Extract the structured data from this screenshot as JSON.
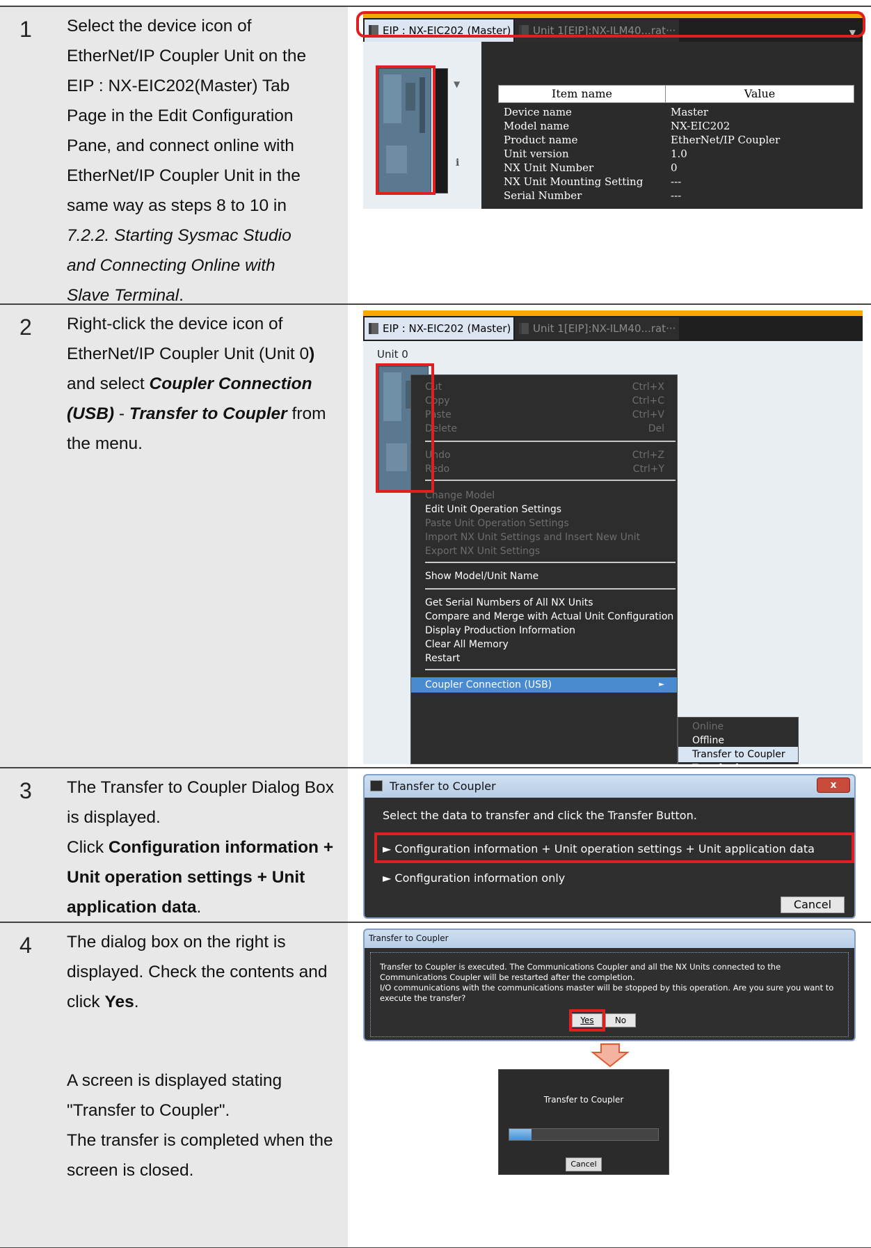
{
  "steps": [
    {
      "num": "1",
      "text_lines": [
        "Select the device icon of",
        "EtherNet/IP Coupler Unit on the",
        "EIP : NX-EIC202(Master) Tab",
        "Page in the Edit Configuration",
        "Pane, and connect online with",
        "EtherNet/IP Coupler Unit in the",
        "same way as steps 8 to 10 in"
      ],
      "text_italic_lines": [
        "7.2.2. Starting Sysmac Studio",
        "and Connecting Online with",
        "Slave Terminal"
      ],
      "text_tail": ".",
      "screen": {
        "tab_active": "EIP : NX-EIC202 (Master)",
        "tab_inactive": "Unit 1[EIP]:NX-ILM40...rat···",
        "table_headers": [
          "Item name",
          "Value"
        ],
        "table_rows": [
          [
            "Device name",
            "Master"
          ],
          [
            "Model name",
            "NX-EIC202"
          ],
          [
            "Product name",
            "EtherNet/IP Coupler"
          ],
          [
            "Unit version",
            "1.0"
          ],
          [
            "NX Unit Number",
            "0"
          ],
          [
            "NX Unit Mounting Setting",
            "---"
          ],
          [
            "Serial Number",
            "---"
          ]
        ]
      }
    },
    {
      "num": "2",
      "text_a": "Right-click the device icon of EtherNet/IP Coupler Unit (Unit 0",
      "text_b": ")",
      "text_c": " and select ",
      "text_bold1": "Coupler Connection (USB)",
      "text_sep": " - ",
      "text_bold2": "Transfer to Coupler",
      "text_end": " from the menu.",
      "screen": {
        "tab_active": "EIP : NX-EIC202 (Master)",
        "tab_inactive": "Unit 1[EIP]:NX-ILM40...rat···",
        "unit_label": "Unit 0",
        "menu_items": [
          {
            "label": "Cut",
            "key": "Ctrl+X",
            "enabled": false
          },
          {
            "label": "Copy",
            "key": "Ctrl+C",
            "enabled": false
          },
          {
            "label": "Paste",
            "key": "Ctrl+V",
            "enabled": false
          },
          {
            "label": "Delete",
            "key": "Del",
            "enabled": false
          },
          {
            "label": "Undo",
            "key": "Ctrl+Z",
            "enabled": false
          },
          {
            "label": "Redo",
            "key": "Ctrl+Y",
            "enabled": false
          },
          {
            "label": "Change Model",
            "key": "",
            "enabled": false
          },
          {
            "label": "Edit Unit Operation Settings",
            "key": "",
            "enabled": true
          },
          {
            "label": "Paste Unit Operation Settings",
            "key": "",
            "enabled": false
          },
          {
            "label": "Import NX Unit Settings and Insert New Unit",
            "key": "",
            "enabled": false
          },
          {
            "label": "Export NX Unit Settings",
            "key": "",
            "enabled": false
          },
          {
            "label": "Show Model/Unit Name",
            "key": "",
            "enabled": true
          },
          {
            "label": "Get Serial Numbers of All NX Units",
            "key": "",
            "enabled": true
          },
          {
            "label": "Compare and Merge with Actual Unit Configuration",
            "key": "",
            "enabled": true
          },
          {
            "label": "Display Production Information",
            "key": "",
            "enabled": true
          },
          {
            "label": "Clear All Memory",
            "key": "",
            "enabled": true
          },
          {
            "label": "Restart",
            "key": "",
            "enabled": true
          },
          {
            "label": "Coupler Connection (USB)",
            "key": "",
            "enabled": true
          }
        ],
        "submenu_items": [
          {
            "label": "Online",
            "enabled": false
          },
          {
            "label": "Offline",
            "enabled": true
          },
          {
            "label": "Transfer to Coupler",
            "enabled": true,
            "highlighted": true
          },
          {
            "label": "Transfer from Coupler",
            "enabled": true
          }
        ]
      }
    },
    {
      "num": "3",
      "text_a": "The Transfer to Coupler Dialog Box is displayed.",
      "text_b": "Click ",
      "text_bold": "Configuration information + Unit operation settings + Unit application data",
      "text_end": ".",
      "screen": {
        "title": "Transfer to Coupler",
        "close": "x",
        "prompt": "Select the data to transfer and click the Transfer Button.",
        "option1": "Configuration information + Unit operation settings + Unit application data",
        "option2": "Configuration information only",
        "cancel": "Cancel"
      }
    },
    {
      "num": "4",
      "text_a": "The dialog box on the right is displayed. Check the contents and click ",
      "text_bold": "Yes",
      "text_end": ".",
      "text_c": "A screen is displayed stating \"Transfer to Coupler\".",
      "text_d": "The transfer is completed when the screen is closed.",
      "screen": {
        "title": "Transfer to Coupler",
        "message": "Transfer to Coupler is executed. The Communications Coupler and all the NX Units connected to the Communications Coupler will be restarted after the completion.\nI/O communications with the communications master will be stopped by this operation. Are you sure you want to execute the transfer?",
        "yes": "Yes",
        "no": "No",
        "progress_title": "Transfer to Coupler",
        "progress_fraction": 0.15,
        "progress_cancel": "Cancel"
      }
    }
  ]
}
